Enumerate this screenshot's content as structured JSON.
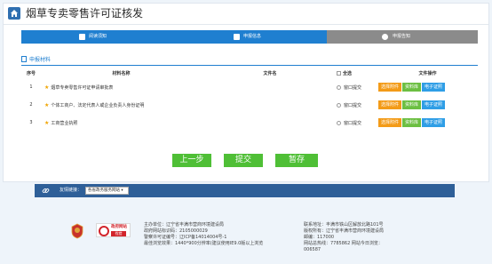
{
  "header": {
    "title": "烟草专卖零售许可证核发"
  },
  "steps": [
    {
      "label": "阅读须知"
    },
    {
      "label": "申报信息"
    },
    {
      "label": "申报告知"
    }
  ],
  "section": {
    "tab_label": "申报材料"
  },
  "table": {
    "headers": {
      "index": "序号",
      "name": "材料名称",
      "file": "文件名",
      "select_all": "全选",
      "ops": "文件操作"
    },
    "rows": [
      {
        "index": "1",
        "name": "烟草专卖零售许可证申请审批表",
        "submit": "窗口提交"
      },
      {
        "index": "2",
        "name": "个体工商户、法定代表人或企业负责人身份证明",
        "submit": "窗口提交"
      },
      {
        "index": "3",
        "name": "工商营业执照",
        "submit": "窗口提交"
      }
    ],
    "op_labels": {
      "select": "选择附件",
      "library": "资料库",
      "license": "电子证照"
    }
  },
  "actions": {
    "prev": "上一步",
    "submit": "提交",
    "save": "暂存"
  },
  "links": {
    "label": "友情链接：",
    "select_value": "各省政务服务网站 ▾"
  },
  "footer": {
    "site_logo": {
      "line1": "政府网站",
      "line2": "找错"
    },
    "org": "主办单位：辽宁省丰满市营商环境建设局",
    "site_code": "政府网站标识码：2105000029",
    "icp": "警察许可证编号：辽ICP备14014004号-1",
    "browser": "最佳浏览效果：1440*900分辨率(建议使用IE9.0版以上浏览",
    "address": "联系地址：丰满市铁山区解放北路101号",
    "copyright": "版权所有：辽宁省丰满市营商环境建设局",
    "postcode": "邮编：117000",
    "phone": "网站总热线：7785862  网站今日浏览：",
    "visits": "006587"
  },
  "colors": {
    "primary": "#1f7fd0",
    "step_inactive": "#8b8b8b",
    "action_green": "#4fbf36",
    "link_bar": "#2e5f98"
  }
}
